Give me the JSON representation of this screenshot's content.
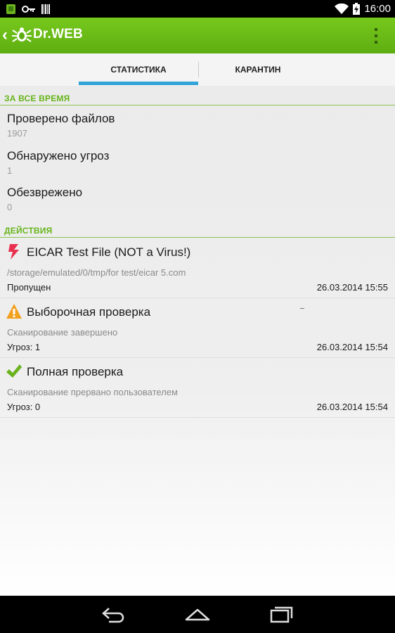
{
  "status_bar": {
    "time": "16:00",
    "icons": [
      "app-notification-icon",
      "key-icon",
      "barcode-icon",
      "wifi-icon",
      "battery-charging-icon"
    ]
  },
  "action_bar": {
    "title": "Dr.WEB",
    "logo_icon": "drweb-spider-icon",
    "overflow_icon": "overflow-menu-icon"
  },
  "tabs": [
    {
      "label": "СТАТИСТИКА",
      "selected": true
    },
    {
      "label": "КАРАНТИН",
      "selected": false
    }
  ],
  "all_time": {
    "header": "ЗА ВСЕ ВРЕМЯ",
    "stats": [
      {
        "title": "Проверено файлов",
        "value": "1907"
      },
      {
        "title": "Обнаружено угроз",
        "value": "1"
      },
      {
        "title": "Обезврежено",
        "value": "0"
      }
    ]
  },
  "actions": {
    "header": "ДЕЙСТВИЯ",
    "items": [
      {
        "icon": "lightning-threat-icon",
        "title": "EICAR Test File (NOT a Virus!)",
        "subtitle": "/storage/emulated/0/tmp/for test/eicar 5.com",
        "status": "Пропущен",
        "date": "26.03.2014 15:55"
      },
      {
        "icon": "warning-icon",
        "title": "Выборочная проверка",
        "subtitle": "Сканирование завершено",
        "status": "Угроз: 1",
        "date": "26.03.2014 15:54"
      },
      {
        "icon": "checkmark-icon",
        "title": "Полная проверка",
        "subtitle": "Сканирование прервано пользователем",
        "status": "Угроз: 0",
        "date": "26.03.2014 15:54"
      }
    ]
  },
  "nav_bar": {
    "buttons": [
      "back-icon",
      "home-icon",
      "recents-icon"
    ]
  },
  "colors": {
    "action_bar": "#6cbd17",
    "section_header": "#67b51a",
    "tab_indicator": "#33a3d8",
    "threat": "#e8304f",
    "warning": "#f2a11f",
    "ok": "#6ab21e"
  }
}
